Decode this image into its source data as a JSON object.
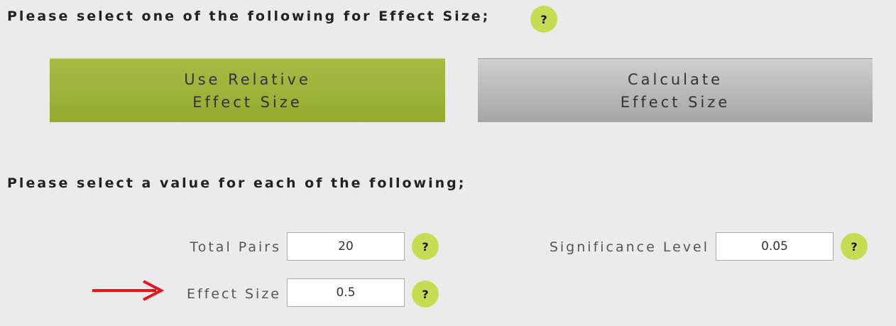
{
  "effect_size_section": {
    "heading": "Please select one of the following for Effect Size;",
    "help_label": "?",
    "relative_button": {
      "line1": "Use Relative",
      "line2": "Effect Size"
    },
    "calculate_button": {
      "line1": "Calculate",
      "line2": "Effect Size"
    }
  },
  "values_section": {
    "heading": "Please select a value for each of the following;",
    "help_label": "?",
    "fields": {
      "total_pairs": {
        "label": "Total Pairs",
        "value": "20"
      },
      "significance_level": {
        "label": "Significance Level",
        "value": "0.05"
      },
      "effect_size": {
        "label": "Effect Size",
        "value": "0.5"
      }
    }
  },
  "colors": {
    "background": "#ebebeb",
    "selected_button": "#9cb23a",
    "unselected_button": "#b8b8b8",
    "help_icon": "#c5dd53",
    "annotation_arrow": "#e8141c"
  }
}
